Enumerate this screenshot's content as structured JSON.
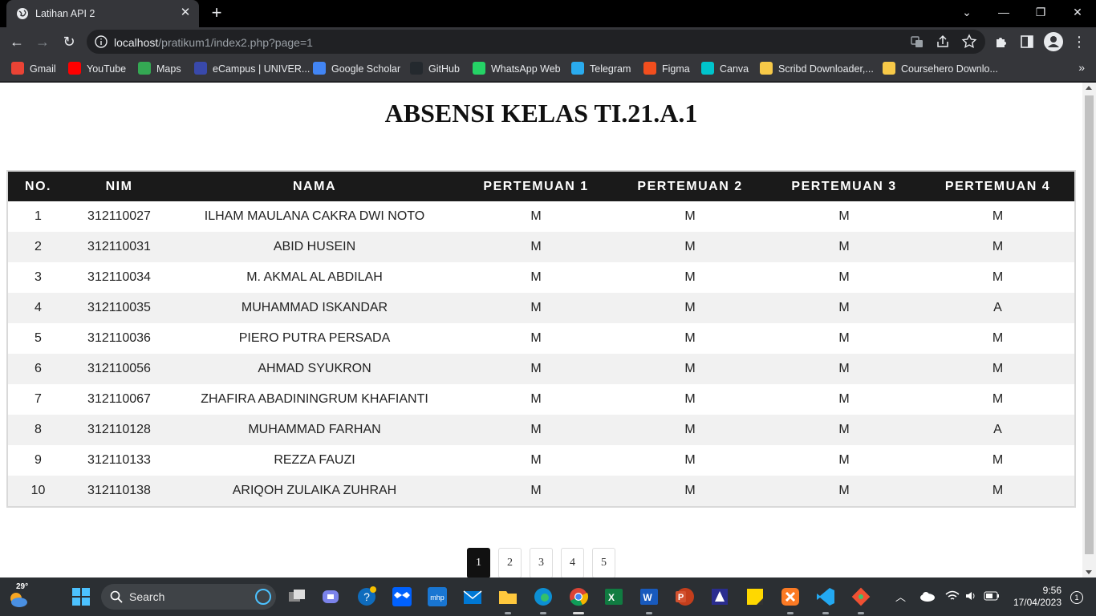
{
  "browser": {
    "tab_title": "Latihan API 2",
    "url_host": "localhost",
    "url_path": "/pratikum1/index2.php?page=1",
    "bookmarks": [
      "Gmail",
      "YouTube",
      "Maps",
      "eCampus | UNIVER...",
      "Google Scholar",
      "GitHub",
      "WhatsApp Web",
      "Telegram",
      "Figma",
      "Canva",
      "Scribd Downloader,...",
      "Coursehero Downlo..."
    ],
    "bookmark_colors": [
      "#ea4335",
      "#ff0000",
      "#34a853",
      "#3949ab",
      "#4285f4",
      "#24292e",
      "#25d366",
      "#2aabee",
      "#f24e1e",
      "#00c4cc",
      "#f7c948",
      "#f7c948"
    ]
  },
  "page": {
    "title": "ABSENSI KELAS TI.21.A.1",
    "table": {
      "headers": [
        "NO.",
        "NIM",
        "NAMA",
        "PERTEMUAN 1",
        "PERTEMUAN 2",
        "PERTEMUAN 3",
        "PERTEMUAN 4"
      ],
      "rows": [
        [
          "1",
          "312110027",
          "ILHAM MAULANA CAKRA DWI NOTO",
          "M",
          "M",
          "M",
          "M"
        ],
        [
          "2",
          "312110031",
          "ABID HUSEIN",
          "M",
          "M",
          "M",
          "M"
        ],
        [
          "3",
          "312110034",
          "M. AKMAL AL ABDILAH",
          "M",
          "M",
          "M",
          "M"
        ],
        [
          "4",
          "312110035",
          "MUHAMMAD ISKANDAR",
          "M",
          "M",
          "M",
          "A"
        ],
        [
          "5",
          "312110036",
          "PIERO PUTRA PERSADA",
          "M",
          "M",
          "M",
          "M"
        ],
        [
          "6",
          "312110056",
          "AHMAD SYUKRON",
          "M",
          "M",
          "M",
          "M"
        ],
        [
          "7",
          "312110067",
          "ZHAFIRA ABADININGRUM KHAFIANTI",
          "M",
          "M",
          "M",
          "M"
        ],
        [
          "8",
          "312110128",
          "MUHAMMAD FARHAN",
          "M",
          "M",
          "M",
          "A"
        ],
        [
          "9",
          "312110133",
          "REZZA FAUZI",
          "M",
          "M",
          "M",
          "M"
        ],
        [
          "10",
          "312110138",
          "ARIQOH ZULAIKA ZUHRAH",
          "M",
          "M",
          "M",
          "M"
        ]
      ]
    },
    "pagination": {
      "pages": [
        "1",
        "2",
        "3",
        "4",
        "5"
      ],
      "active": "1"
    }
  },
  "taskbar": {
    "weather_temp": "29°",
    "search_label": "Search",
    "time": "9:56",
    "date": "17/04/2023",
    "notification_count": "1"
  }
}
